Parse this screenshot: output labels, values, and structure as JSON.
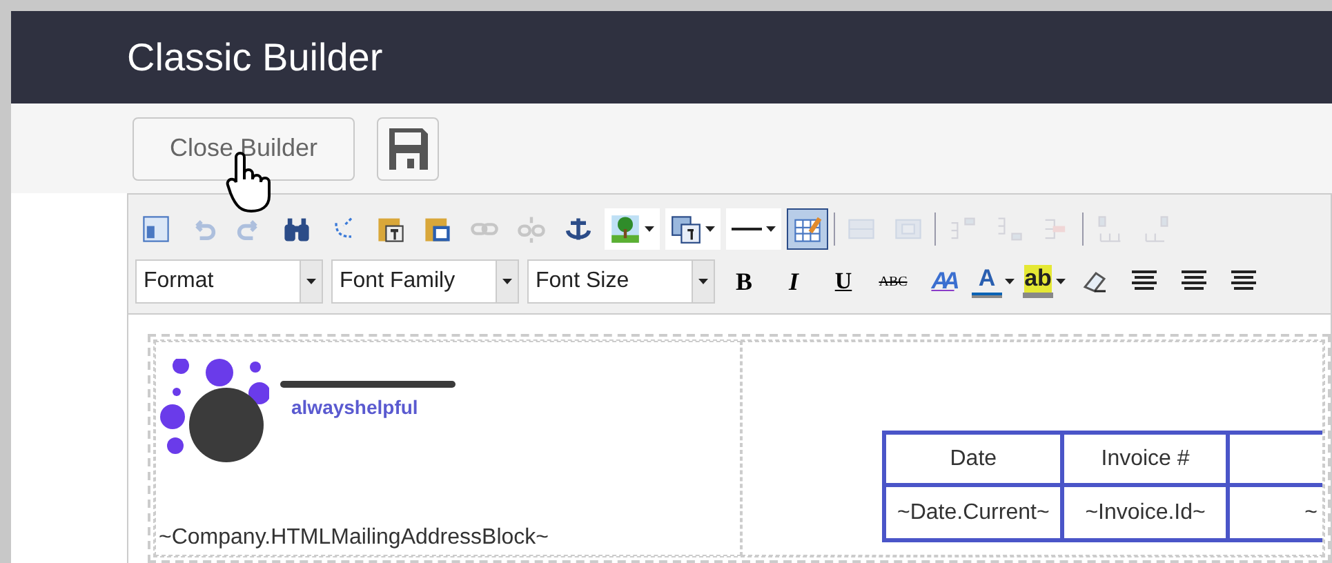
{
  "header": {
    "title": "Classic Builder"
  },
  "actions": {
    "close_button": "Close Builder"
  },
  "toolbar": {
    "row_1": [
      {
        "disabled": false,
        "selected": false,
        "menu": false
      },
      {
        "disabled": true,
        "selected": false,
        "menu": false
      },
      {
        "disabled": true,
        "selected": false,
        "menu": false
      },
      {
        "disabled": false,
        "selected": false,
        "menu": false
      },
      {
        "disabled": false,
        "selected": false,
        "menu": false
      },
      {
        "disabled": false,
        "selected": false,
        "menu": false
      },
      {
        "disabled": false,
        "selected": false,
        "menu": false
      },
      {
        "disabled": true,
        "selected": false,
        "menu": false
      },
      {
        "disabled": true,
        "selected": false,
        "menu": false
      },
      {
        "disabled": false,
        "selected": false,
        "menu": false
      },
      {
        "disabled": false,
        "selected": false,
        "menu": true
      },
      {
        "disabled": false,
        "selected": false,
        "menu": true
      },
      {
        "disabled": false,
        "selected": false,
        "menu": true
      },
      {
        "disabled": false,
        "selected": true,
        "menu": false
      },
      {
        "disabled": true,
        "selected": false,
        "menu": false
      },
      {
        "disabled": true,
        "selected": false,
        "menu": false
      },
      {
        "disabled": true,
        "selected": false,
        "menu": false
      },
      {
        "disabled": true,
        "selected": false,
        "menu": false
      },
      {
        "disabled": true,
        "selected": false,
        "menu": false
      },
      {
        "disabled": true,
        "selected": false,
        "menu": false
      },
      {
        "disabled": true,
        "selected": false,
        "menu": false
      }
    ],
    "selects": [
      {
        "label": "Format"
      },
      {
        "label": "Font Family"
      },
      {
        "label": "Font Size"
      }
    ],
    "row_2": [
      {
        "kind": "bold",
        "label": "B"
      },
      {
        "kind": "italic",
        "label": "I"
      },
      {
        "kind": "underline",
        "label": "U"
      },
      {
        "kind": "strike",
        "label": "ABC"
      },
      {
        "kind": "styles",
        "label": "AA"
      },
      {
        "kind": "color",
        "label": "A",
        "color": "#0a63b5",
        "menu": true
      },
      {
        "kind": "highlight",
        "label": "ab",
        "color": "#e5e834",
        "menu": true
      },
      {
        "kind": "eraser"
      },
      {
        "kind": "align"
      },
      {
        "kind": "align"
      },
      {
        "kind": "align"
      }
    ]
  },
  "document": {
    "logo_text": "alwayshelpful",
    "address": "~Company.HTMLMailingAddressBlock~",
    "table": {
      "columns": [
        "Date",
        "Invoice #",
        ""
      ],
      "rows": [
        [
          "~Date.Current~",
          "~Invoice.Id~",
          "~"
        ]
      ]
    }
  }
}
